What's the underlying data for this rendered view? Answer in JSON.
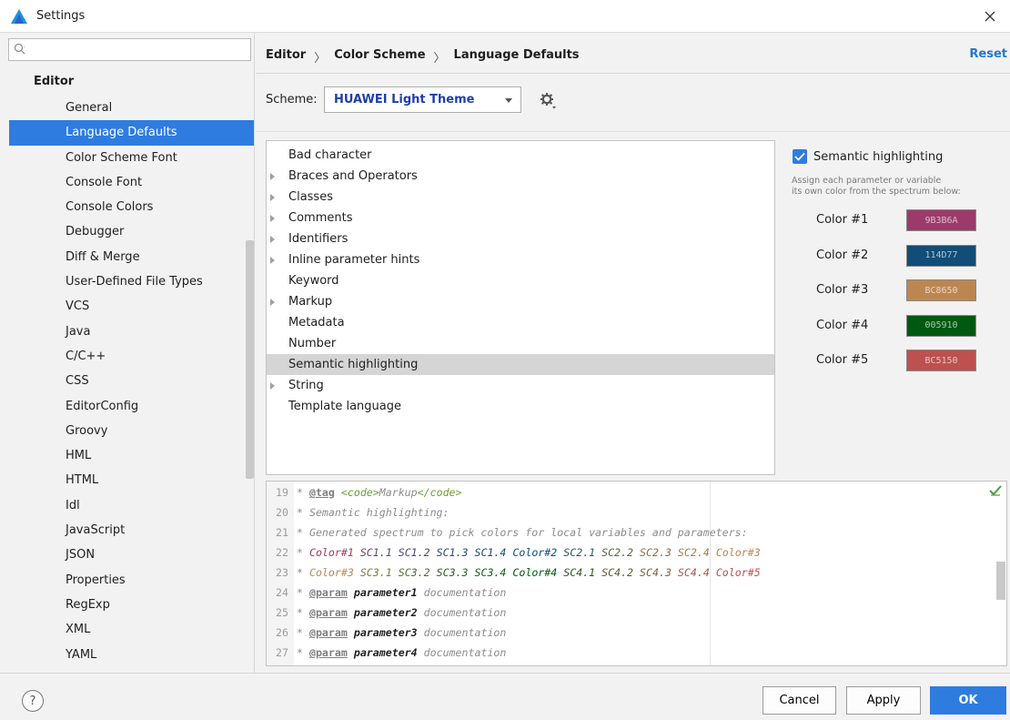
{
  "window": {
    "title": "Settings"
  },
  "sidebar": {
    "search_placeholder": "",
    "root": "Editor",
    "items": [
      {
        "label": "General"
      },
      {
        "label": "Language Defaults"
      },
      {
        "label": "Color Scheme Font"
      },
      {
        "label": "Console Font"
      },
      {
        "label": "Console Colors"
      },
      {
        "label": "Debugger"
      },
      {
        "label": "Diff & Merge"
      },
      {
        "label": "User-Defined File Types"
      },
      {
        "label": "VCS"
      },
      {
        "label": "Java"
      },
      {
        "label": "C/C++"
      },
      {
        "label": "CSS"
      },
      {
        "label": "EditorConfig"
      },
      {
        "label": "Groovy"
      },
      {
        "label": "HML"
      },
      {
        "label": "HTML"
      },
      {
        "label": "Idl"
      },
      {
        "label": "JavaScript"
      },
      {
        "label": "JSON"
      },
      {
        "label": "Properties"
      },
      {
        "label": "RegExp"
      },
      {
        "label": "XML"
      },
      {
        "label": "YAML"
      }
    ],
    "selected_index": 1
  },
  "header": {
    "breadcrumb": [
      "Editor",
      "Color Scheme",
      "Language Defaults"
    ],
    "separator": "〉",
    "reset": "Reset"
  },
  "scheme": {
    "label": "Scheme:",
    "value": "HUAWEI Light Theme"
  },
  "attributes": [
    {
      "label": "Bad character",
      "expandable": false
    },
    {
      "label": "Braces and Operators",
      "expandable": true
    },
    {
      "label": "Classes",
      "expandable": true
    },
    {
      "label": "Comments",
      "expandable": true
    },
    {
      "label": "Identifiers",
      "expandable": true
    },
    {
      "label": "Inline parameter hints",
      "expandable": true
    },
    {
      "label": "Keyword",
      "expandable": false
    },
    {
      "label": "Markup",
      "expandable": true
    },
    {
      "label": "Metadata",
      "expandable": false
    },
    {
      "label": "Number",
      "expandable": false
    },
    {
      "label": "Semantic highlighting",
      "expandable": false,
      "selected": true
    },
    {
      "label": "String",
      "expandable": true
    },
    {
      "label": "Template language",
      "expandable": false
    }
  ],
  "semantic": {
    "checkbox_label": "Semantic highlighting",
    "checked": true,
    "description_line1": "Assign each parameter or variable",
    "description_line2": "its own color from the spectrum below:",
    "colors": [
      {
        "label": "Color #1",
        "hex": "9B3B6A",
        "color": "#9B3B6A"
      },
      {
        "label": "Color #2",
        "hex": "114D77",
        "color": "#114D77"
      },
      {
        "label": "Color #3",
        "hex": "BC8650",
        "color": "#BC8650"
      },
      {
        "label": "Color #4",
        "hex": "005910",
        "color": "#005910"
      },
      {
        "label": "Color #5",
        "hex": "BC5150",
        "color": "#BC5150"
      }
    ]
  },
  "preview": {
    "lines": [
      {
        "n": "19",
        "star": "*",
        "tag": "@tag",
        "code_open": "<code>",
        "text": "Markup",
        "code_close": "</code>"
      },
      {
        "n": "20",
        "text": "* Semantic highlighting:"
      },
      {
        "n": "21",
        "text": "* Generated spectrum to pick colors for local variables and parameters:"
      },
      {
        "n": "22",
        "star": "*",
        "tokens": [
          {
            "t": "Color#1",
            "c": "#9B3B6A"
          },
          {
            "t": "SC1.1",
            "c": "#6f3f6a"
          },
          {
            "t": "SC1.2",
            "c": "#4f4572"
          },
          {
            "t": "SC1.3",
            "c": "#2c4a74"
          },
          {
            "t": "SC1.4",
            "c": "#1a4c76"
          },
          {
            "t": "Color#2",
            "c": "#114D77"
          },
          {
            "t": "SC2.1",
            "c": "#2c5c5a"
          },
          {
            "t": "SC2.2",
            "c": "#4a6a3c"
          },
          {
            "t": "SC2.3",
            "c": "#8a7040"
          },
          {
            "t": "SC2.4",
            "c": "#a87a48"
          },
          {
            "t": "Color#3",
            "c": "#BC8650"
          }
        ]
      },
      {
        "n": "23",
        "star": "*",
        "tokens": [
          {
            "t": "Color#3",
            "c": "#BC8650"
          },
          {
            "t": "SC3.1",
            "c": "#7f7a3c"
          },
          {
            "t": "SC3.2",
            "c": "#4f6f28"
          },
          {
            "t": "SC3.3",
            "c": "#2a6420"
          },
          {
            "t": "SC3.4",
            "c": "#10601a"
          },
          {
            "t": "Color#4",
            "c": "#005910"
          },
          {
            "t": "SC4.1",
            "c": "#2a5a20"
          },
          {
            "t": "SC4.2",
            "c": "#5a5a30"
          },
          {
            "t": "SC4.3",
            "c": "#8a5a40"
          },
          {
            "t": "SC4.4",
            "c": "#a85548"
          },
          {
            "t": "Color#5",
            "c": "#BC5150"
          }
        ]
      },
      {
        "n": "24",
        "star": "*",
        "tag": "@param",
        "pname": "parameter1",
        "text": "documentation"
      },
      {
        "n": "25",
        "star": "*",
        "tag": "@param",
        "pname": "parameter2",
        "text": "documentation"
      },
      {
        "n": "26",
        "star": "*",
        "tag": "@param",
        "pname": "parameter3",
        "text": "documentation"
      },
      {
        "n": "27",
        "star": "*",
        "tag": "@param",
        "pname": "parameter4",
        "text": "documentation"
      }
    ]
  },
  "footer": {
    "help": "?",
    "cancel": "Cancel",
    "apply": "Apply",
    "ok": "OK"
  },
  "colors": {
    "accent": "#2F7CE0",
    "scheme_text": "#1F3FA8"
  }
}
